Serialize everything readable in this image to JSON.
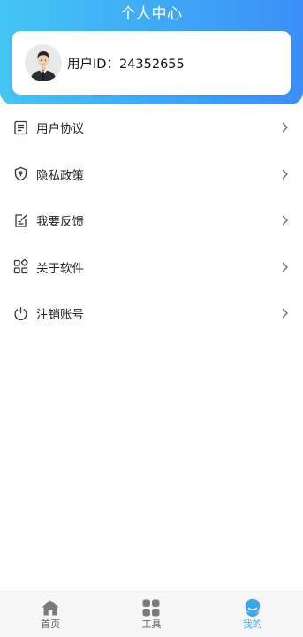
{
  "header": {
    "title": "个人中心",
    "gradient_start": "#43c6f5",
    "gradient_end": "#3b8ff7"
  },
  "profile": {
    "avatar_icon": "businessman-avatar",
    "user_id_text": "用户ID：24352655"
  },
  "menu": {
    "items": [
      {
        "label": "用户协议",
        "icon": "document-icon"
      },
      {
        "label": "隐私政策",
        "icon": "shield-icon"
      },
      {
        "label": "我要反馈",
        "icon": "edit-icon"
      },
      {
        "label": "关于软件",
        "icon": "apps-icon"
      },
      {
        "label": "注销账号",
        "icon": "power-icon"
      }
    ],
    "chevron_icon": "chevron-right-icon"
  },
  "tabbar": {
    "active_color": "#3ba7ea",
    "tabs": [
      {
        "label": "首页",
        "icon": "home-icon",
        "active": false
      },
      {
        "label": "工具",
        "icon": "grid-icon",
        "active": false
      },
      {
        "label": "我的",
        "icon": "user-icon",
        "active": true
      }
    ]
  }
}
